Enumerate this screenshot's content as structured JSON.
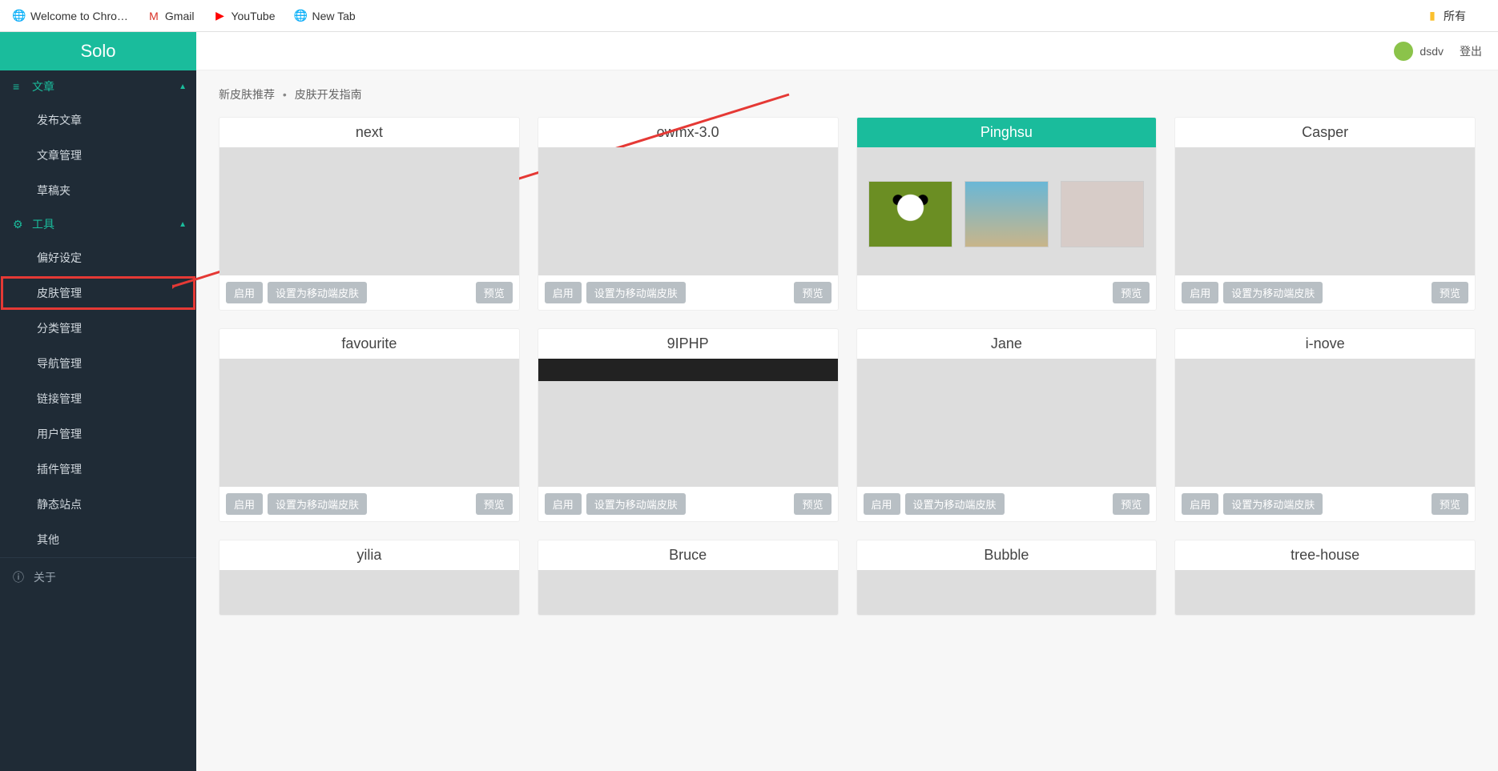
{
  "bookmarks": {
    "welcome": "Welcome to Chro…",
    "gmail": "Gmail",
    "youtube": "YouTube",
    "newtab": "New Tab",
    "right": "所有"
  },
  "brand": "Solo",
  "sidebar": {
    "articles_label": "文章",
    "articles": {
      "publish": "发布文章",
      "manage": "文章管理",
      "drafts": "草稿夹"
    },
    "tools_label": "工具",
    "tools": {
      "preferences": "偏好设定",
      "skins": "皮肤管理",
      "categories": "分类管理",
      "nav": "导航管理",
      "links": "链接管理",
      "users": "用户管理",
      "plugins": "插件管理",
      "static": "静态站点",
      "other": "其他"
    },
    "about": "关于"
  },
  "topbar": {
    "user": "dsdv",
    "logout": "登出"
  },
  "breadcrumb": {
    "a": "新皮肤推荐",
    "b": "皮肤开发指南"
  },
  "buttons": {
    "enable": "启用",
    "set_mobile": "设置为移动端皮肤",
    "preview": "预览"
  },
  "skins": [
    {
      "name": "next",
      "active": false,
      "footer": "full",
      "thumb": "thumb-white"
    },
    {
      "name": "owmx-3.0",
      "active": false,
      "footer": "full",
      "thumb": "thumb-blue"
    },
    {
      "name": "Pinghsu",
      "active": true,
      "footer": "preview",
      "thumb": "thumb-gallery"
    },
    {
      "name": "Casper",
      "active": false,
      "footer": "full",
      "thumb": "thumb-casper"
    },
    {
      "name": "favourite",
      "active": false,
      "footer": "full",
      "thumb": "thumb-collage"
    },
    {
      "name": "9IPHP",
      "active": false,
      "footer": "full",
      "thumb": "thumb-layout"
    },
    {
      "name": "Jane",
      "active": false,
      "footer": "full",
      "thumb": "thumb-flowers"
    },
    {
      "name": "i-nove",
      "active": false,
      "footer": "full",
      "thumb": "thumb-inove"
    },
    {
      "name": "yilia",
      "active": false,
      "footer": "none",
      "thumb": "thumb-grey"
    },
    {
      "name": "Bruce",
      "active": false,
      "footer": "none",
      "thumb": "thumb-white"
    },
    {
      "name": "Bubble",
      "active": false,
      "footer": "none",
      "thumb": "thumb-mix"
    },
    {
      "name": "tree-house",
      "active": false,
      "footer": "none",
      "thumb": "thumb-teal"
    }
  ]
}
